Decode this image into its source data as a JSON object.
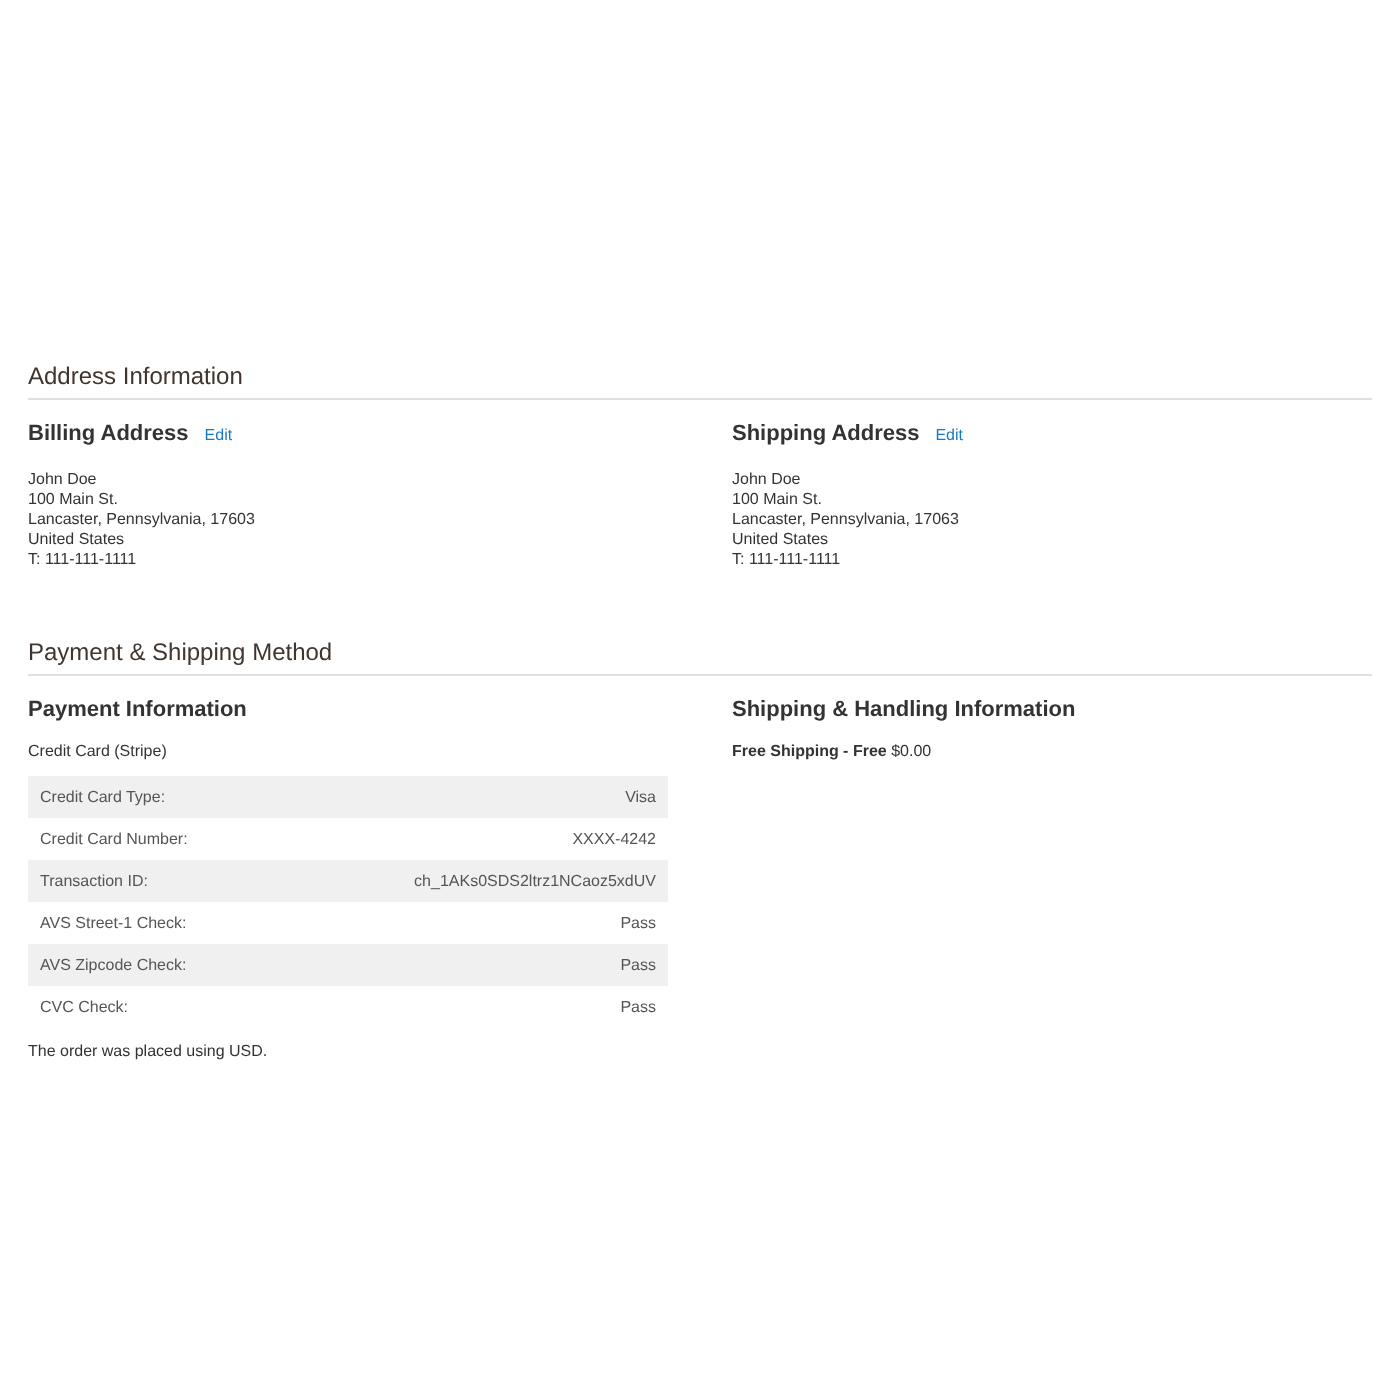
{
  "address_section": {
    "title": "Address Information",
    "billing": {
      "title": "Billing Address",
      "edit": "Edit",
      "lines": [
        "John Doe",
        "100 Main St.",
        "Lancaster, Pennsylvania, 17603",
        "United States",
        "T: 111-111-1111"
      ]
    },
    "shipping": {
      "title": "Shipping Address",
      "edit": "Edit",
      "lines": [
        "John Doe",
        "100 Main St.",
        "Lancaster, Pennsylvania, 17063",
        "United States",
        "T: 111-111-1111"
      ]
    }
  },
  "method_section": {
    "title": "Payment & Shipping Method",
    "payment": {
      "title": "Payment Information",
      "method": "Credit Card (Stripe)",
      "rows": [
        {
          "label": "Credit Card Type:",
          "value": "Visa"
        },
        {
          "label": "Credit Card Number:",
          "value": "XXXX-4242"
        },
        {
          "label": "Transaction ID:",
          "value": "ch_1AKs0SDS2ltrz1NCaoz5xdUV"
        },
        {
          "label": "AVS Street-1 Check:",
          "value": "Pass"
        },
        {
          "label": "AVS Zipcode Check:",
          "value": "Pass"
        },
        {
          "label": "CVC Check:",
          "value": "Pass"
        }
      ],
      "note": "The order was placed using USD."
    },
    "shipping": {
      "title": "Shipping & Handling Information",
      "text": "**Free Shipping - Free** $0.00"
    }
  }
}
